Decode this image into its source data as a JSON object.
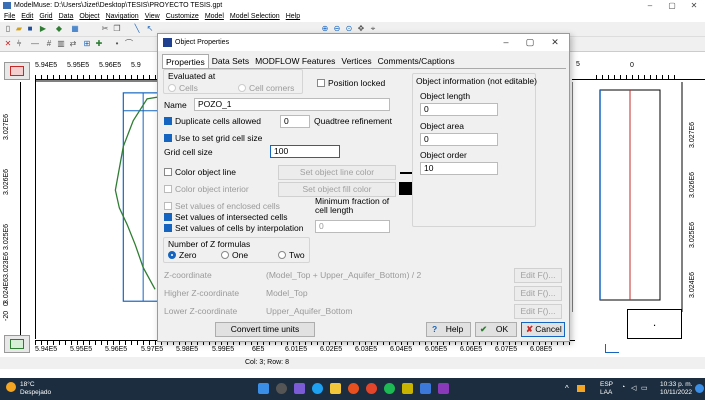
{
  "window": {
    "title": "ModelMuse: D:\\Users\\Jizet\\Desktop\\TESIS\\PROYECTO TESIS.gpt"
  },
  "menu": [
    "File",
    "Edit",
    "Grid",
    "Data",
    "Object",
    "Navigation",
    "View",
    "Customize",
    "Model",
    "Model Selection",
    "Help"
  ],
  "rulers": {
    "top_left_ticks": [
      "5.94E5",
      "5.95E5",
      "5.96E5",
      "5.9"
    ],
    "top_right_tick": "0",
    "top_right_partial": "5",
    "left_ticks": [
      "3.027E6",
      "3.026E6",
      "3.025E6",
      "3.024E6",
      "3.023E6",
      "-20",
      "0"
    ],
    "right_ticks": [
      "3.027E6",
      "3.026E6",
      "3.025E6",
      "3.024E6",
      "3.023E6"
    ],
    "bottom_ticks": [
      "5.94E5",
      "5.95E5",
      "5.96E5",
      "5.97E5",
      "5.98E5",
      "5.99E5",
      "6E5",
      "6.01E5",
      "6.02E5",
      "6.03E5",
      "6.04E5",
      "6.05E5",
      "6.06E5",
      "6.07E5",
      "6.08E5"
    ],
    "side_view_marker": "."
  },
  "status": {
    "cell": "Col: 3; Row: 8"
  },
  "dialog": {
    "title": "Object Properties",
    "tabs": [
      "Properties",
      "Data Sets",
      "MODFLOW Features",
      "Vertices",
      "Comments/Captions"
    ],
    "evaluated_at": "Evaluated at",
    "cells": "Cells",
    "cell_corners": "Cell corners",
    "position_locked": "Position locked",
    "name_label": "Name",
    "name_value": "POZO_1",
    "duplicate_cells": "Duplicate cells allowed",
    "quadtree_value": "0",
    "quadtree_label": "Quadtree refinement",
    "use_grid_size": "Use to set grid cell size",
    "grid_cell_size_label": "Grid cell size",
    "grid_cell_size_value": "100",
    "color_line": "Color object line",
    "set_line_color": "Set object line color",
    "color_interior": "Color object interior",
    "set_fill_color": "Set object fill color",
    "enclosed": "Set values of enclosed cells",
    "intersected": "Set values of intersected cells",
    "interpolation": "Set values of cells by interpolation",
    "min_fraction": "Minimum fraction of cell length",
    "min_fraction_value": "0",
    "num_z": "Number of Z formulas",
    "z_zero": "Zero",
    "z_one": "One",
    "z_two": "Two",
    "z_coord_label": "Z-coordinate",
    "z_coord_value": "(Model_Top + Upper_Aquifer_Bottom) / 2",
    "higher_z_label": "Higher Z-coordinate",
    "higher_z_value": "Model_Top",
    "lower_z_label": "Lower Z-coordinate",
    "lower_z_value": "Upper_Aquifer_Bottom",
    "edit_f": "Edit F()...",
    "info_title": "Object information (not editable)",
    "obj_length_label": "Object length",
    "obj_length_value": "0",
    "obj_area_label": "Object area",
    "obj_area_value": "0",
    "obj_order_label": "Object order",
    "obj_order_value": "10",
    "convert_time": "Convert time units",
    "help": "Help",
    "ok": "OK",
    "cancel": "Cancel"
  },
  "taskbar": {
    "weather_temp": "18°C",
    "weather_desc": "Despejado",
    "lang1": "ESP",
    "lang2": "LAA",
    "time": "10:33 p. m.",
    "date": "10/11/2022"
  }
}
